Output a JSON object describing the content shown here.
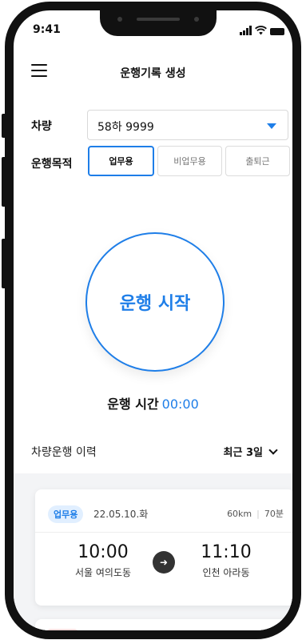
{
  "status": {
    "time": "9:41"
  },
  "header": {
    "title": "운행기록 생성"
  },
  "vehicle": {
    "label": "차량",
    "value": "58하 9999"
  },
  "purpose": {
    "label": "운행목적",
    "options": [
      "업무용",
      "비업무용",
      "출퇴근"
    ],
    "selected": "업무용"
  },
  "start_button": {
    "label": "운행 시작"
  },
  "drive_time": {
    "label": "운행 시간",
    "value": "00:00"
  },
  "history": {
    "title": "차량운행 이력",
    "range": "최근 3일",
    "items": [
      {
        "badge": "업무용",
        "date": "22.05.10.화",
        "distance": "60km",
        "duration": "70분",
        "depart_time": "10:00",
        "depart_place": "서울 여의도동",
        "arrive_time": "11:10",
        "arrive_place": "인천 아라동"
      }
    ]
  },
  "colors": {
    "accent": "#1e7ee8",
    "badge_bg": "#e1efff",
    "history_bg": "#f3f4f6"
  }
}
